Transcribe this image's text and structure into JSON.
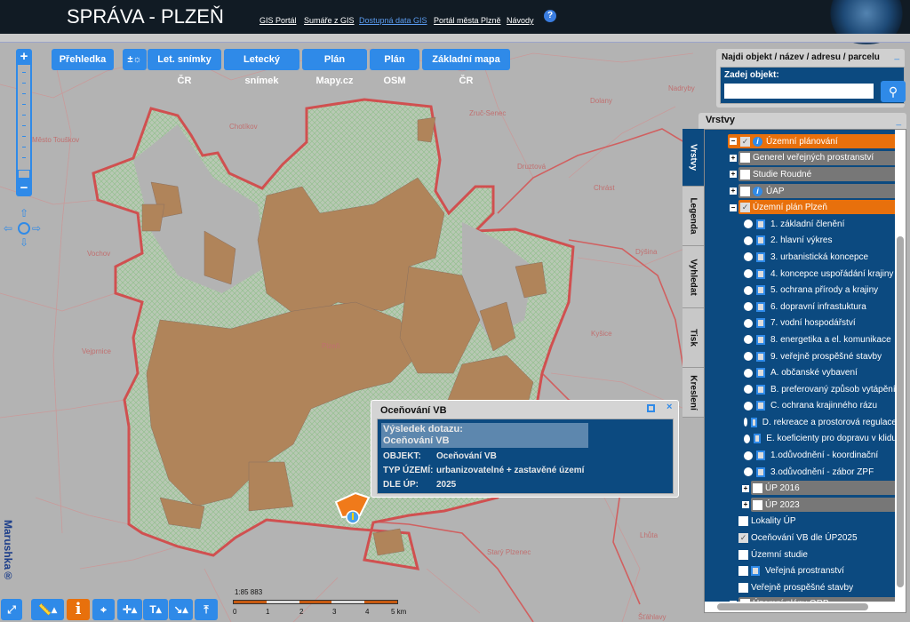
{
  "header": {
    "title": "SPRÁVA - PLZEŇ",
    "links": [
      "GIS Portál",
      "Sumáře z GIS",
      "Dostupná data GIS",
      "Portál města Plzně",
      "Návody"
    ],
    "help": "?"
  },
  "map_buttons": [
    "Přehledka",
    "±☼",
    "Let. snímky ČR",
    "Letecký snímek",
    "Plán Mapy.cz",
    "Plán OSM",
    "Základní mapa ČR"
  ],
  "map": {
    "places": [
      "Plzeň",
      "Chrást",
      "Dýšina",
      "Kyšice",
      "Starý Plzenec",
      "Lhůta",
      "Šťáhlavy",
      "Chotíkov",
      "Vochov",
      "Vejprnice",
      "Zruč-Senec",
      "Druztová",
      "Dolany",
      "Nadryby",
      "Město Touškov"
    ],
    "colors": {
      "built": "#b0845a",
      "boundary": "#d05050",
      "green": "#a8c4a0",
      "bg": "#b3b3b3"
    }
  },
  "zoom": {
    "plus": "+",
    "minus": "−"
  },
  "brand": "Marushka®",
  "scale": {
    "ratio": "1:85 883",
    "labels": [
      "0",
      "1",
      "2",
      "3",
      "4",
      "5 km"
    ]
  },
  "toolbar": {
    "info": "i"
  },
  "search": {
    "title": "Najdi objekt / název / adresu / parcelu",
    "label": "Zadej objekt:",
    "value": "",
    "minimize": "_"
  },
  "layers": {
    "title": "Vrstvy",
    "minimize": "_",
    "tabs": [
      "Vrstvy",
      "Legenda",
      "Vyhledat",
      "Tisk",
      "Kreslení"
    ],
    "rows": [
      {
        "label": "Územní plánování",
        "level": 0,
        "expand": "−",
        "check": true,
        "info": true,
        "style": "orange"
      },
      {
        "label": "Generel veřejných prostranství",
        "level": 1,
        "expand": "+",
        "check": false,
        "style": "gray"
      },
      {
        "label": "Studie Roudné",
        "level": 1,
        "expand": "+",
        "check": false,
        "style": "gray"
      },
      {
        "label": "ÚAP",
        "level": 1,
        "expand": "+",
        "check": false,
        "info": true,
        "style": "gray"
      },
      {
        "label": "Územní plán Plzeň",
        "level": 1,
        "expand": "−",
        "check": true,
        "style": "orange"
      },
      {
        "label": "1. základní členění",
        "level": 2,
        "radio": true
      },
      {
        "label": "2. hlavní výkres",
        "level": 2,
        "radio": true
      },
      {
        "label": "3. urbanistická koncepce",
        "level": 2,
        "radio": true
      },
      {
        "label": "4. koncepce uspořádání krajiny",
        "level": 2,
        "radio": true
      },
      {
        "label": "5. ochrana přírody a krajiny",
        "level": 2,
        "radio": true
      },
      {
        "label": "6. dopravní infrastuktura",
        "level": 2,
        "radio": true
      },
      {
        "label": "7. vodní hospodářství",
        "level": 2,
        "radio": true
      },
      {
        "label": "8. energetika a el. komunikace",
        "level": 2,
        "radio": true
      },
      {
        "label": "9. veřejně prospěšné stavby",
        "level": 2,
        "radio": true
      },
      {
        "label": "A. občanské vybavení",
        "level": 2,
        "radio": true
      },
      {
        "label": "B. preferovaný způsob vytápění",
        "level": 2,
        "radio": true
      },
      {
        "label": "C. ochrana krajinného rázu",
        "level": 2,
        "radio": true
      },
      {
        "label": "D. rekreace a prostorová regulace",
        "level": 2,
        "radio": true
      },
      {
        "label": "E. koeficienty pro dopravu v klidu",
        "level": 2,
        "radio": true
      },
      {
        "label": "1.odůvodnění - koordinační",
        "level": 2,
        "radio": true
      },
      {
        "label": "3.odůvodnění - zábor ZPF",
        "level": 2,
        "radio": true
      },
      {
        "label": "ÚP 2016",
        "level": 2,
        "expand": "+",
        "check": false,
        "style": "gray"
      },
      {
        "label": "ÚP 2023",
        "level": 2,
        "expand": "+",
        "check": false,
        "style": "gray"
      },
      {
        "label": "Lokality ÚP",
        "level": 3,
        "check": false
      },
      {
        "label": "Oceňování VB dle ÚP2025",
        "level": 3,
        "check": true
      },
      {
        "label": "Územní studie",
        "level": 3,
        "check": false
      },
      {
        "label": "Veřejná prostranství",
        "level": 3,
        "check": false,
        "doc": true
      },
      {
        "label": "Veřejně prospěšné stavby",
        "level": 3,
        "check": false
      },
      {
        "label": "Územní plány ORP",
        "level": 1,
        "expand": "+",
        "check": false,
        "style": "gray"
      }
    ]
  },
  "popup": {
    "title": "Oceňování VB",
    "result_label": "Výsledek dotazu:",
    "result_name": "Oceňování VB",
    "fields": [
      {
        "key": "OBJEKT:",
        "value": "Oceňování VB"
      },
      {
        "key": "TYP ÚZEMÍ:",
        "value": "urbanizovatelné + zastavěné území"
      },
      {
        "key": "DLE ÚP:",
        "value": "2025"
      }
    ]
  }
}
